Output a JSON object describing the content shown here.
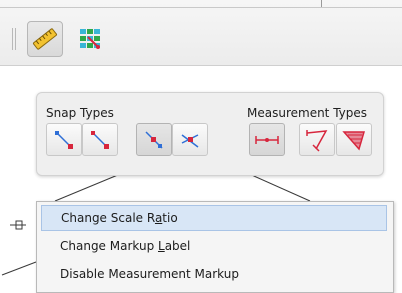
{
  "toolbar": {
    "buttons": [
      {
        "icon": "ruler-icon",
        "active": true
      },
      {
        "icon": "grid-snap-icon",
        "active": false
      }
    ]
  },
  "panel": {
    "snap_types_label": "Snap Types",
    "measurement_types_label": "Measurement Types",
    "snap_buttons": [
      {
        "icon": "snap-endpoint-icon"
      },
      {
        "icon": "snap-line-endpoint-icon"
      },
      {
        "icon": "snap-midpoint-icon",
        "selected": true
      },
      {
        "icon": "snap-intersection-icon"
      }
    ],
    "measurement_buttons": [
      {
        "icon": "measure-length-icon",
        "selected": true
      },
      {
        "icon": "measure-polyline-icon"
      },
      {
        "icon": "measure-area-icon"
      }
    ]
  },
  "context_menu": {
    "items": [
      {
        "label_pre": "Change Scale R",
        "mnemonic": "a",
        "label_post": "tio",
        "highlighted": true
      },
      {
        "label_pre": "Change Markup ",
        "mnemonic": "L",
        "label_post": "abel",
        "highlighted": false
      },
      {
        "label_pre": "Disable Measurement Markup",
        "mnemonic": "",
        "label_post": "",
        "highlighted": false
      }
    ]
  },
  "colors": {
    "accent_red": "#d7263d",
    "accent_blue": "#2f6fd6",
    "menu_highlight": "#d8e6f6"
  }
}
